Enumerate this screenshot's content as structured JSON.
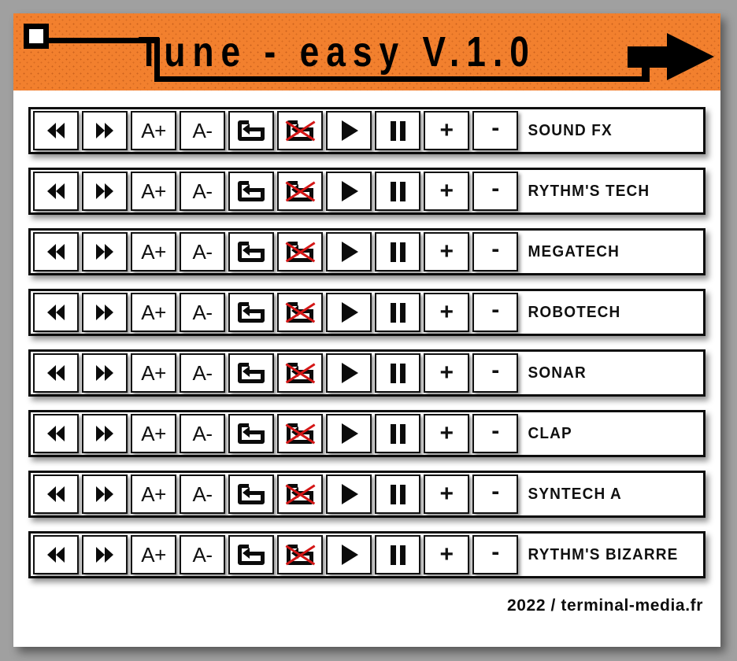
{
  "app": {
    "title": "Tune - easy  V.1.0",
    "header_accent_color": "#f2802e",
    "square_badge_color": "#ffffff",
    "arrow_icon": "arrow-right-icon"
  },
  "controls": [
    {
      "key": "rewind",
      "icon": "rewind-icon",
      "label": ""
    },
    {
      "key": "forward",
      "icon": "fast-forward-icon",
      "label": ""
    },
    {
      "key": "volume_up",
      "icon": "text-larger-icon",
      "label": "A+"
    },
    {
      "key": "volume_dn",
      "icon": "text-smaller-icon",
      "label": "A-"
    },
    {
      "key": "loop_on",
      "icon": "loop-icon",
      "label": ""
    },
    {
      "key": "loop_off",
      "icon": "loop-disabled-icon",
      "label": ""
    },
    {
      "key": "play",
      "icon": "play-icon",
      "label": ""
    },
    {
      "key": "pause",
      "icon": "pause-icon",
      "label": ""
    },
    {
      "key": "plus",
      "icon": "plus-icon",
      "label": "+"
    },
    {
      "key": "minus",
      "icon": "minus-icon",
      "label": "-"
    }
  ],
  "tracks": [
    {
      "name": "SOUND FX"
    },
    {
      "name": "RYTHM'S TECH"
    },
    {
      "name": "MEGATECH"
    },
    {
      "name": "ROBOTECH"
    },
    {
      "name": "SONAR"
    },
    {
      "name": "CLAP"
    },
    {
      "name": "SYNTECH A"
    },
    {
      "name": "RYTHM'S BIZARRE"
    }
  ],
  "footer": {
    "credit": "2022 / terminal-media.fr"
  },
  "colors": {
    "background": "#a0a0a0",
    "panel": "#ffffff",
    "accent_orange": "#f2802e",
    "ink": "#0b0b0b",
    "disabled_cross": "#d41616"
  }
}
